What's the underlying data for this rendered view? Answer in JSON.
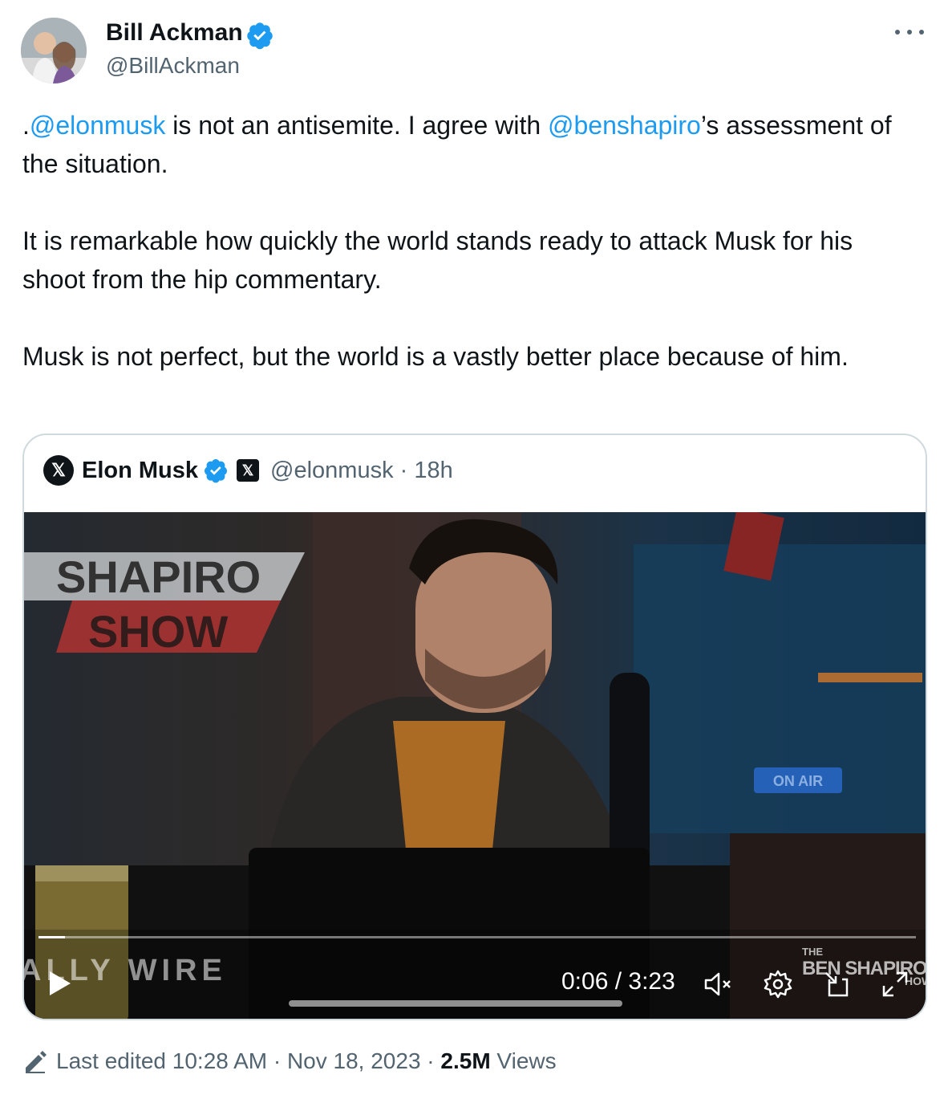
{
  "author": {
    "name": "Bill Ackman",
    "handle": "@BillAckman"
  },
  "tweet": {
    "p1": {
      "prefix": ".",
      "mention1": "@elonmusk",
      "mid": " is not an antisemite. I agree with ",
      "mention2": "@benshapiro",
      "suffix": "’s assessment of the situation."
    },
    "p2": "It is remarkable how quickly the world stands ready to attack Musk for his shoot from the hip commentary.",
    "p3": "Musk is not perfect, but the world is a vastly better place because of him."
  },
  "quoted": {
    "avatar_glyph": "𝕏",
    "name": "Elon Musk",
    "badge_glyph": "𝕏",
    "handle_time": "@elonmusk · 18h",
    "video": {
      "progress": 0.03,
      "time": "0:06 / 3:23",
      "overlay_text": {
        "sign_line1": "SHAPIRO",
        "sign_line2": "SHOW",
        "on_air": "ON AIR",
        "wire": "ALLY WIRE",
        "ben_small": "THE",
        "ben_main": "BEN SHAPIRO",
        "ben_tail": "HOW"
      },
      "controls": [
        "play-icon",
        "mute-icon",
        "settings-icon",
        "pip-icon",
        "fullscreen-icon"
      ]
    }
  },
  "footer": {
    "edited": "Last edited 10:28 AM · Nov 18, 2023 · ",
    "views_count": "2.5M",
    "views_label": " Views"
  },
  "colors": {
    "link": "#1d9bf0",
    "secondary": "#536471",
    "text": "#0f1419",
    "verified": "#1d9bf0"
  }
}
